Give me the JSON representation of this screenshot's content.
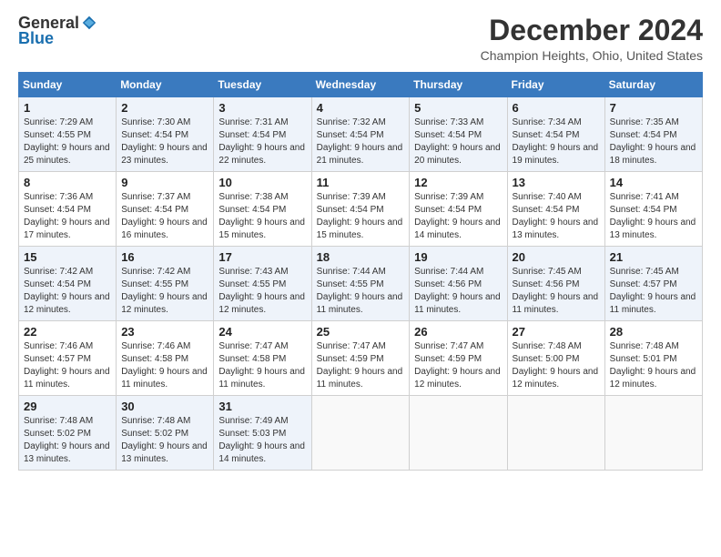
{
  "header": {
    "logo_general": "General",
    "logo_blue": "Blue",
    "month_title": "December 2024",
    "location": "Champion Heights, Ohio, United States"
  },
  "days_of_week": [
    "Sunday",
    "Monday",
    "Tuesday",
    "Wednesday",
    "Thursday",
    "Friday",
    "Saturday"
  ],
  "weeks": [
    [
      {
        "day": "1",
        "sunrise": "7:29 AM",
        "sunset": "4:55 PM",
        "daylight": "9 hours and 25 minutes."
      },
      {
        "day": "2",
        "sunrise": "7:30 AM",
        "sunset": "4:54 PM",
        "daylight": "9 hours and 23 minutes."
      },
      {
        "day": "3",
        "sunrise": "7:31 AM",
        "sunset": "4:54 PM",
        "daylight": "9 hours and 22 minutes."
      },
      {
        "day": "4",
        "sunrise": "7:32 AM",
        "sunset": "4:54 PM",
        "daylight": "9 hours and 21 minutes."
      },
      {
        "day": "5",
        "sunrise": "7:33 AM",
        "sunset": "4:54 PM",
        "daylight": "9 hours and 20 minutes."
      },
      {
        "day": "6",
        "sunrise": "7:34 AM",
        "sunset": "4:54 PM",
        "daylight": "9 hours and 19 minutes."
      },
      {
        "day": "7",
        "sunrise": "7:35 AM",
        "sunset": "4:54 PM",
        "daylight": "9 hours and 18 minutes."
      }
    ],
    [
      {
        "day": "8",
        "sunrise": "7:36 AM",
        "sunset": "4:54 PM",
        "daylight": "9 hours and 17 minutes."
      },
      {
        "day": "9",
        "sunrise": "7:37 AM",
        "sunset": "4:54 PM",
        "daylight": "9 hours and 16 minutes."
      },
      {
        "day": "10",
        "sunrise": "7:38 AM",
        "sunset": "4:54 PM",
        "daylight": "9 hours and 15 minutes."
      },
      {
        "day": "11",
        "sunrise": "7:39 AM",
        "sunset": "4:54 PM",
        "daylight": "9 hours and 15 minutes."
      },
      {
        "day": "12",
        "sunrise": "7:39 AM",
        "sunset": "4:54 PM",
        "daylight": "9 hours and 14 minutes."
      },
      {
        "day": "13",
        "sunrise": "7:40 AM",
        "sunset": "4:54 PM",
        "daylight": "9 hours and 13 minutes."
      },
      {
        "day": "14",
        "sunrise": "7:41 AM",
        "sunset": "4:54 PM",
        "daylight": "9 hours and 13 minutes."
      }
    ],
    [
      {
        "day": "15",
        "sunrise": "7:42 AM",
        "sunset": "4:54 PM",
        "daylight": "9 hours and 12 minutes."
      },
      {
        "day": "16",
        "sunrise": "7:42 AM",
        "sunset": "4:55 PM",
        "daylight": "9 hours and 12 minutes."
      },
      {
        "day": "17",
        "sunrise": "7:43 AM",
        "sunset": "4:55 PM",
        "daylight": "9 hours and 12 minutes."
      },
      {
        "day": "18",
        "sunrise": "7:44 AM",
        "sunset": "4:55 PM",
        "daylight": "9 hours and 11 minutes."
      },
      {
        "day": "19",
        "sunrise": "7:44 AM",
        "sunset": "4:56 PM",
        "daylight": "9 hours and 11 minutes."
      },
      {
        "day": "20",
        "sunrise": "7:45 AM",
        "sunset": "4:56 PM",
        "daylight": "9 hours and 11 minutes."
      },
      {
        "day": "21",
        "sunrise": "7:45 AM",
        "sunset": "4:57 PM",
        "daylight": "9 hours and 11 minutes."
      }
    ],
    [
      {
        "day": "22",
        "sunrise": "7:46 AM",
        "sunset": "4:57 PM",
        "daylight": "9 hours and 11 minutes."
      },
      {
        "day": "23",
        "sunrise": "7:46 AM",
        "sunset": "4:58 PM",
        "daylight": "9 hours and 11 minutes."
      },
      {
        "day": "24",
        "sunrise": "7:47 AM",
        "sunset": "4:58 PM",
        "daylight": "9 hours and 11 minutes."
      },
      {
        "day": "25",
        "sunrise": "7:47 AM",
        "sunset": "4:59 PM",
        "daylight": "9 hours and 11 minutes."
      },
      {
        "day": "26",
        "sunrise": "7:47 AM",
        "sunset": "4:59 PM",
        "daylight": "9 hours and 12 minutes."
      },
      {
        "day": "27",
        "sunrise": "7:48 AM",
        "sunset": "5:00 PM",
        "daylight": "9 hours and 12 minutes."
      },
      {
        "day": "28",
        "sunrise": "7:48 AM",
        "sunset": "5:01 PM",
        "daylight": "9 hours and 12 minutes."
      }
    ],
    [
      {
        "day": "29",
        "sunrise": "7:48 AM",
        "sunset": "5:02 PM",
        "daylight": "9 hours and 13 minutes."
      },
      {
        "day": "30",
        "sunrise": "7:48 AM",
        "sunset": "5:02 PM",
        "daylight": "9 hours and 13 minutes."
      },
      {
        "day": "31",
        "sunrise": "7:49 AM",
        "sunset": "5:03 PM",
        "daylight": "9 hours and 14 minutes."
      },
      null,
      null,
      null,
      null
    ]
  ]
}
